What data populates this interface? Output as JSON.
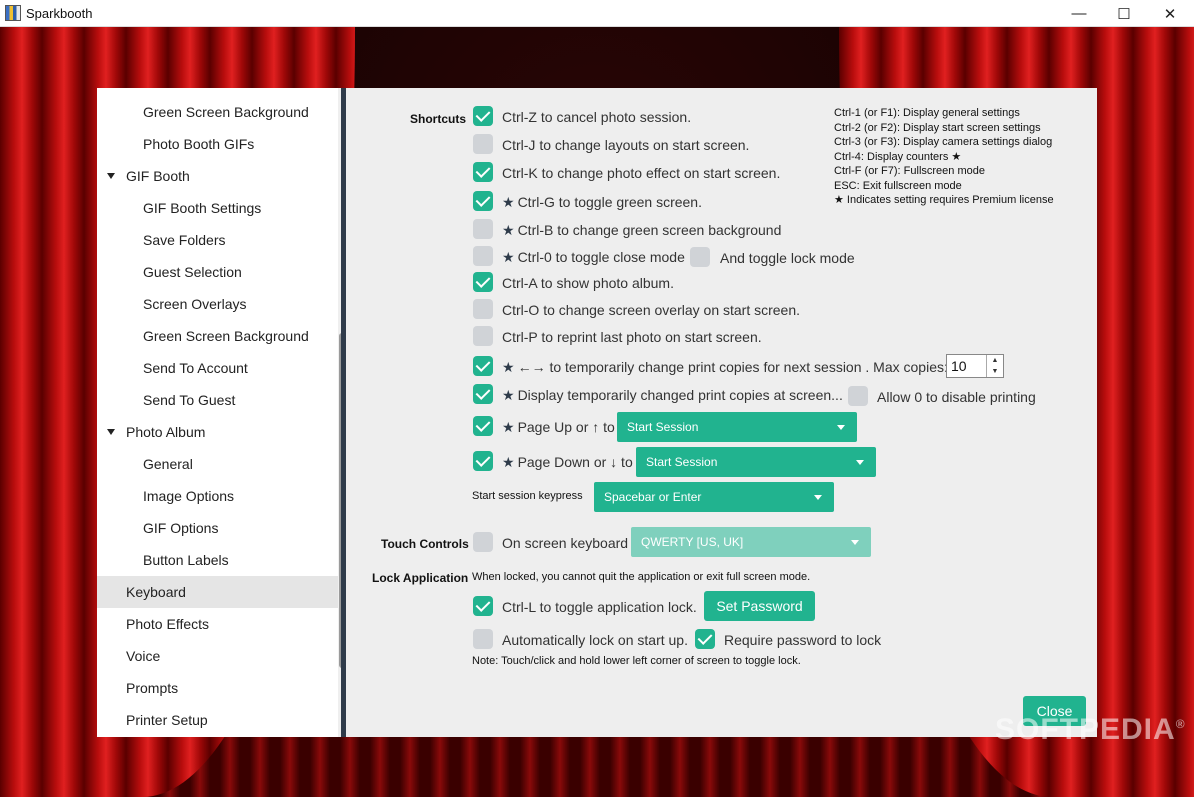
{
  "window": {
    "title": "Sparkbooth",
    "minimize": "—",
    "maximize": "☐",
    "close": "✕"
  },
  "watermark": {
    "text": "SOFTPEDIA",
    "mark": "®"
  },
  "sidebar": {
    "items": [
      {
        "label": "Green Screen Background",
        "level": "sub"
      },
      {
        "label": "Photo Booth GIFs",
        "level": "sub"
      },
      {
        "label": "GIF Booth",
        "level": "top",
        "expanded": true
      },
      {
        "label": "GIF Booth Settings",
        "level": "sub"
      },
      {
        "label": "Save Folders",
        "level": "sub"
      },
      {
        "label": "Guest Selection",
        "level": "sub"
      },
      {
        "label": "Screen Overlays",
        "level": "sub"
      },
      {
        "label": "Green Screen Background",
        "level": "sub"
      },
      {
        "label": "Send To Account",
        "level": "sub"
      },
      {
        "label": "Send To Guest",
        "level": "sub"
      },
      {
        "label": "Photo Album",
        "level": "top",
        "expanded": true
      },
      {
        "label": "General",
        "level": "sub"
      },
      {
        "label": "Image Options",
        "level": "sub"
      },
      {
        "label": "GIF Options",
        "level": "sub"
      },
      {
        "label": "Button Labels",
        "level": "sub"
      },
      {
        "label": "Keyboard",
        "level": "top",
        "selected": true
      },
      {
        "label": "Photo Effects",
        "level": "top"
      },
      {
        "label": "Voice",
        "level": "top"
      },
      {
        "label": "Prompts",
        "level": "top"
      },
      {
        "label": "Printer Setup",
        "level": "top"
      }
    ]
  },
  "shortcuts": {
    "section": "Shortcuts",
    "star": "★",
    "rows": [
      {
        "label": "Ctrl-Z to cancel photo session.",
        "checked": true
      },
      {
        "label": "Ctrl-J to change layouts on start screen.",
        "checked": false
      },
      {
        "label": "Ctrl-K to change photo effect on start screen.",
        "checked": true
      },
      {
        "label": "Ctrl-G to toggle green screen.",
        "checked": true,
        "premium": true
      },
      {
        "label": "Ctrl-B to change green screen background",
        "checked": false,
        "premium": true
      },
      {
        "label": "Ctrl-0 to toggle close mode",
        "checked": false,
        "premium": true
      },
      {
        "label": "Ctrl-A to show photo album.",
        "checked": true
      },
      {
        "label": "Ctrl-O to change screen overlay on start screen.",
        "checked": false
      },
      {
        "label": "Ctrl-P to reprint last photo on start screen.",
        "checked": false
      },
      {
        "label": "←→ to temporarily change print copies for next session . Max copies:",
        "checked": true,
        "premium": true
      },
      {
        "label": "Display temporarily changed print copies at screen...",
        "checked": true,
        "premium": true
      },
      {
        "label": "Page Up or ↑ to",
        "checked": true,
        "premium": true
      },
      {
        "label": "Page Down or ↓ to",
        "checked": true,
        "premium": true
      }
    ],
    "lock_mode": {
      "label": "And toggle lock mode",
      "checked": false
    },
    "allow_zero": {
      "label": "Allow 0 to disable printing",
      "checked": false
    },
    "max_copies": "10",
    "page_up_action": "Start Session",
    "page_down_action": "Start Session",
    "keypress_label": "Start session keypress",
    "keypress_value": "Spacebar or Enter",
    "help": [
      "Ctrl-1 (or F1): Display general settings",
      "Ctrl-2 (or F2): Display start screen settings",
      "Ctrl-3 (or F3): Display camera settings dialog",
      "Ctrl-4: Display counters ★",
      "Ctrl-F (or F7): Fullscreen mode",
      "ESC: Exit fullscreen mode",
      "★ Indicates setting requires Premium license"
    ]
  },
  "touch": {
    "section": "Touch Controls",
    "label": "On screen keyboard",
    "checked": false,
    "layout": "QWERTY [US, UK]"
  },
  "lock": {
    "section": "Lock Application",
    "desc": "When locked, you cannot quit the application or exit full screen mode.",
    "ctrl_l": {
      "label": "Ctrl-L to toggle application lock.",
      "checked": true
    },
    "set_password": "Set Password",
    "auto_lock": {
      "label": "Automatically lock on start up.",
      "checked": false
    },
    "require_pw": {
      "label": "Require password to lock",
      "checked": true
    },
    "note": "Note: Touch/click and hold lower left corner of screen to toggle lock."
  },
  "footer": {
    "close": "Close"
  },
  "colors": {
    "accent": "#21b38f",
    "curtain": "#c41010",
    "panel": "#eeeeee"
  }
}
